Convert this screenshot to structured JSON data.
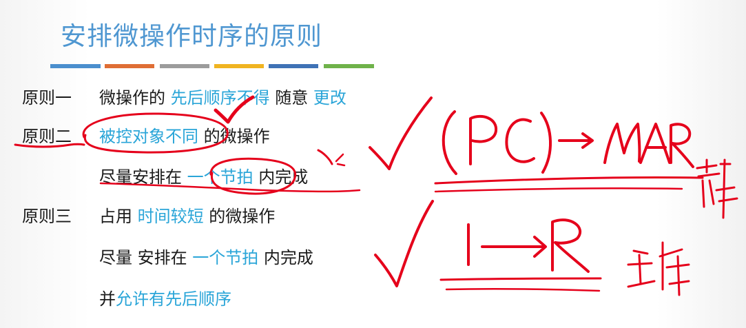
{
  "title": "安排微操作时序的原则",
  "color_bars": [
    "#4b8fce",
    "#df6e35",
    "#9c9c9c",
    "#f0b421",
    "#3f72b6",
    "#6fb24a"
  ],
  "accent_color": "#2aa5d8",
  "principles": [
    {
      "label": "原则一",
      "lines": [
        [
          {
            "t": "微操作的 ",
            "hl": false
          },
          {
            "t": "先后顺序不得",
            "hl": true
          },
          {
            "t": " 随意 ",
            "hl": false
          },
          {
            "t": "更改",
            "hl": true
          }
        ]
      ]
    },
    {
      "label": "原则二",
      "lines": [
        [
          {
            "t": "被控对象不同",
            "hl": true
          },
          {
            "t": " 的微操作",
            "hl": false
          }
        ],
        [
          {
            "t": "尽量安排在 ",
            "hl": false
          },
          {
            "t": "一个节拍",
            "hl": true
          },
          {
            "t": " 内完成",
            "hl": false
          }
        ]
      ]
    },
    {
      "label": "原则三",
      "lines": [
        [
          {
            "t": "占用 ",
            "hl": false
          },
          {
            "t": "时间较短",
            "hl": true
          },
          {
            "t": " 的微操作",
            "hl": false
          }
        ],
        [
          {
            "t": "尽量 安排在 ",
            "hl": false
          },
          {
            "t": "一个节拍",
            "hl": true
          },
          {
            "t": " 内完成",
            "hl": false
          }
        ],
        [
          {
            "t": "并",
            "hl": false
          },
          {
            "t": "允许有先后顺序",
            "hl": true
          }
        ]
      ]
    }
  ],
  "handwriting": {
    "line1": "(PC)→MAR",
    "note1": "寄存",
    "line2": "1→R",
    "note2": "主存",
    "color": "#e5001b"
  }
}
